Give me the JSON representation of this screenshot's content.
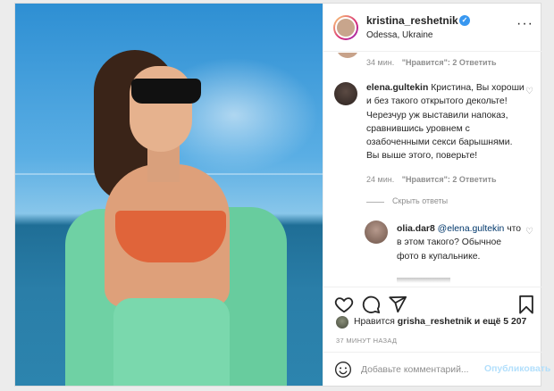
{
  "post": {
    "photo_alt": "",
    "header": {
      "username": "kristina_reshetnik",
      "location": "Odessa, Ukraine",
      "more_icon": "more-dots-icon",
      "more": "···"
    },
    "comments": {
      "previous_meta": {
        "time": "34 мин.",
        "likes": "\"Нравится\": 2",
        "reply": "Ответить"
      },
      "items": [
        {
          "username": "elena.gultekin",
          "text": "Кристина, Вы хороши и без такого открытого декольте! Черезчур уж выставили напоказ, сравнившись уровнем с озабоченными секси барышнями. Вы выше этого, поверьте!",
          "time": "24 мин.",
          "likes": "\"Нравится\": 2",
          "reply": "Ответить"
        }
      ],
      "hide_replies": "Скрыть ответы",
      "reply_item": {
        "username": "olia.dar8",
        "mention": "@elena.gultekin",
        "text": "что в этом такого? Обычное фото в купальнике."
      }
    },
    "likes": {
      "prefix": "Нравится",
      "user": "grisha_reshetnik",
      "suffix": "и ещё 5 207"
    },
    "time_ago": "37 МИНУТ НАЗАД",
    "add_comment": {
      "placeholder": "Добавьте комментарий...",
      "publish": "Опубликовать"
    },
    "icons": {
      "verified": "verified-badge-icon",
      "like": "heart-icon",
      "comment": "comment-icon",
      "share": "share-icon",
      "save": "bookmark-icon",
      "emoji": "emoji-icon"
    },
    "colors": {
      "link_blue": "#00376b",
      "verified_blue": "#3897f0",
      "publish_disabled": "#b2dffc",
      "muted": "#8e8e8e"
    }
  }
}
